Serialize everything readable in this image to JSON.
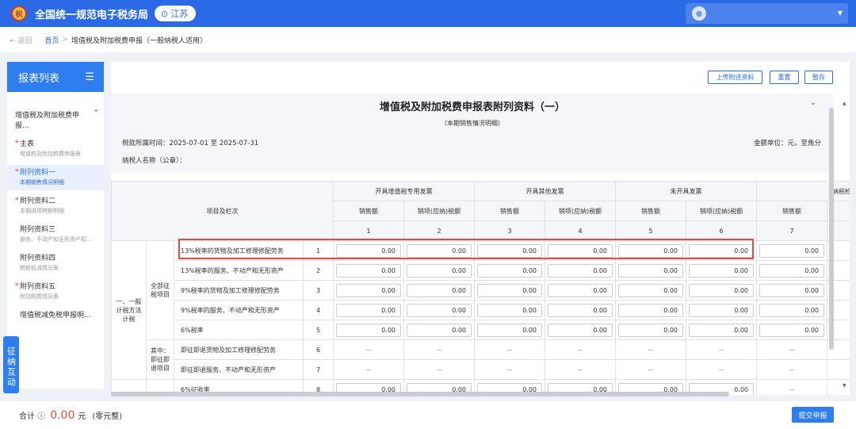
{
  "header": {
    "title": "全国统一规范电子税务局",
    "region": "江苏",
    "logo_text": "税"
  },
  "breadcrumb": {
    "back": "← 返回",
    "home": "首页",
    "sep": ">",
    "current": "增值税及附加税费申报（一般纳税人适用）"
  },
  "sidebar": {
    "title": "报表列表",
    "group": "增值税及附加税费申报...",
    "items": [
      {
        "star": "*",
        "label": "主表",
        "sub": "增值税及附加税费申报表",
        "active": false
      },
      {
        "star": "*",
        "label": "附列资料一",
        "sub": "本期销售情况明细",
        "active": true
      },
      {
        "star": "*",
        "label": "附列资料二",
        "sub": "本期进项税额明细",
        "active": false
      },
      {
        "star": "",
        "label": "附列资料三",
        "sub": "服务、不动产和无形资产扣...",
        "active": false
      },
      {
        "star": "",
        "label": "附列资料四",
        "sub": "税额抵减情况表",
        "active": false
      },
      {
        "star": "*",
        "label": "附列资料五",
        "sub": "附加税费情况表",
        "active": false
      },
      {
        "star": "",
        "label": "增值税减免税申报明...",
        "sub": "",
        "active": false
      }
    ],
    "float_button": "征纳互动"
  },
  "toolbar": {
    "upload": "上传附送资料",
    "reset": "重置",
    "save": "暂存"
  },
  "form": {
    "title": "增值税及附加税费申报表附列资料（一）",
    "subtitle": "（本期销售情况明细）",
    "period": "税款所属时间：2025-07-01 至 2025-07-31",
    "unit": "金额单位：元，至角分",
    "taxpayer": "纳税人名称（公章）："
  },
  "table": {
    "item_header": "项目及栏次",
    "groups": [
      "开具增值税专用发票",
      "开具其他发票",
      "未开具发票",
      "纳税检查"
    ],
    "subcols": [
      "销售额",
      "销项(应纳)税额",
      "销售额",
      "销项(应纳)税额",
      "销售额",
      "销项(应纳)税额",
      "销售额"
    ],
    "colnums": [
      "1",
      "2",
      "3",
      "4",
      "5",
      "6",
      "7"
    ],
    "section": "一、一般计税方法计税",
    "group_all": "全部征税项目",
    "group_among": "其中：即征即退项目",
    "rows": [
      {
        "label": "13%税率的货物及加工修理修配劳务",
        "num": "1",
        "values": [
          "0.00",
          "0.00",
          "0.00",
          "0.00",
          "0.00",
          "0.00",
          "0.00"
        ],
        "input": true
      },
      {
        "label": "13%税率的服务、不动产和无形资产",
        "num": "2",
        "values": [
          "0.00",
          "0.00",
          "0.00",
          "0.00",
          "0.00",
          "0.00",
          "0.00"
        ],
        "input": true
      },
      {
        "label": "9%税率的货物及加工修理修配劳务",
        "num": "3",
        "values": [
          "0.00",
          "0.00",
          "0.00",
          "0.00",
          "0.00",
          "0.00",
          "0.00"
        ],
        "input": true
      },
      {
        "label": "9%税率的服务、不动产和无形资产",
        "num": "4",
        "values": [
          "0.00",
          "0.00",
          "0.00",
          "0.00",
          "0.00",
          "0.00",
          "0.00"
        ],
        "input": true
      },
      {
        "label": "6%税率",
        "num": "5",
        "values": [
          "0.00",
          "0.00",
          "0.00",
          "0.00",
          "0.00",
          "0.00",
          "0.00"
        ],
        "input": true
      },
      {
        "label": "即征即退货物及加工修理修配劳务",
        "num": "6",
        "values": [
          "--",
          "--",
          "--",
          "--",
          "--",
          "--",
          "--"
        ],
        "input": false
      },
      {
        "label": "即征即退服务、不动产和无形资产",
        "num": "7",
        "values": [
          "--",
          "--",
          "--",
          "--",
          "--",
          "--",
          "--"
        ],
        "input": false
      },
      {
        "label": "6%征收率",
        "num": "8",
        "values": [
          "0.00",
          "0.00",
          "0.00",
          "0.00",
          "0.00",
          "0.00",
          "--"
        ],
        "input": true
      }
    ]
  },
  "footer": {
    "total_label": "合计 ⓘ",
    "total_amount": "0.00",
    "total_unit": "元",
    "total_words": "(零元整)",
    "submit": "提交申报"
  }
}
